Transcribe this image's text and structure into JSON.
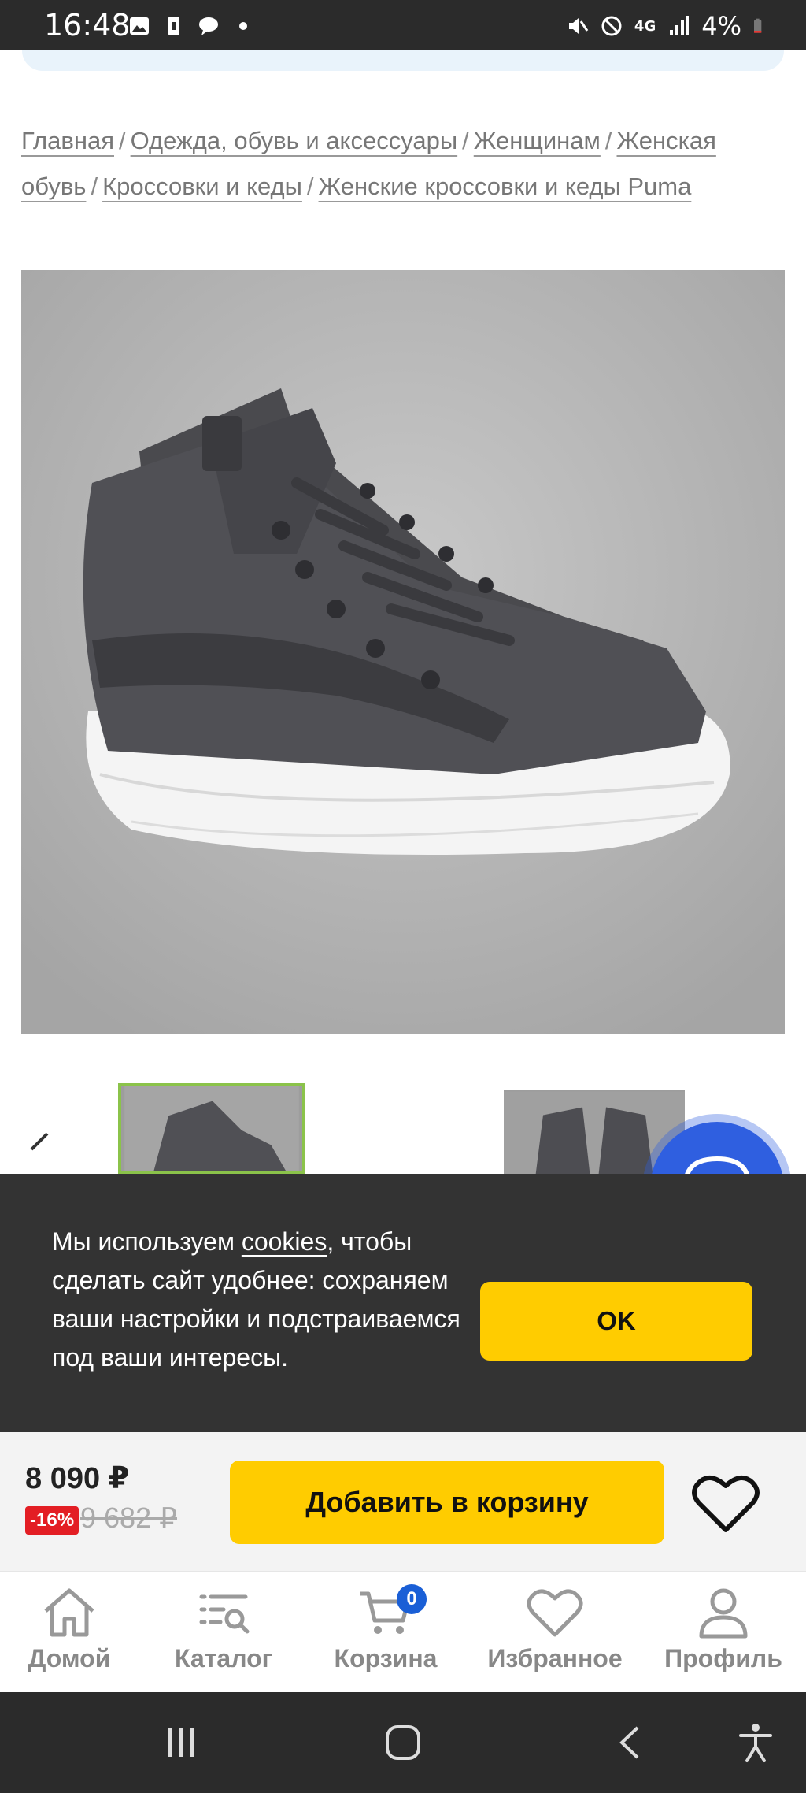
{
  "status_bar": {
    "time": "16:48",
    "battery": "4%",
    "network": "4G",
    "icons_left": [
      "image-icon",
      "battery-saver-icon",
      "chat-bubble-icon",
      "dot-icon"
    ],
    "icons_right": [
      "mute-icon",
      "dnd-icon",
      "4g-icon",
      "signal-icon",
      "battery-icon"
    ]
  },
  "breadcrumb": [
    {
      "label": "Главная"
    },
    {
      "label": "Одежда, обувь и аксессуары"
    },
    {
      "label": "Женщинам"
    },
    {
      "label": "Женская обувь"
    },
    {
      "label": "Кроссовки и кеды"
    },
    {
      "label": "Женские кроссовки и кеды Puma"
    }
  ],
  "breadcrumb_separator": "/",
  "product": {
    "image_alt": "sneaker-photo",
    "thumbnails_count": 2
  },
  "cookie": {
    "text_before": "Мы используем ",
    "link": "cookies",
    "text_after": ", чтобы сделать сайт удобнее: сохраняем ваши настройки и подстраиваемся под ваши интересы.",
    "ok_label": "OK"
  },
  "buy_bar": {
    "price": "8 090 ₽",
    "discount": "-16%",
    "old_price": "9 682 ₽",
    "add_to_cart_label": "Добавить в корзину"
  },
  "bottom_nav": {
    "home": "Домой",
    "catalog": "Каталог",
    "cart": "Корзина",
    "cart_count": "0",
    "favorites": "Избранное",
    "profile": "Профиль"
  },
  "colors": {
    "accent_yellow": "#ffcc00",
    "chat_blue": "#2f5fe0",
    "discount_red": "#e31e24",
    "thumb_active_border": "#8bc34a",
    "cookie_bg": "#333333"
  }
}
